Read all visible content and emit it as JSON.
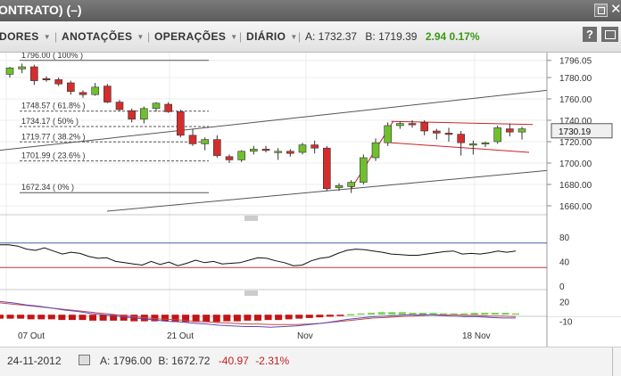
{
  "window": {
    "title": "ONTRATO) (–)",
    "close_glyph": "✕",
    "maximize_icon": "maximize-icon"
  },
  "toolbar": {
    "indicators_label": "DORES",
    "annotations_label": "ANOTAÇÕES",
    "operations_label": "OPERAÇÕES",
    "period_label": "DIÁRIO",
    "separator": "|",
    "ask": "A: 1732.37",
    "bid": "B: 1719.39",
    "change": "2.94 0.17%",
    "help_label": "?",
    "caret_icon": "chevron-down-icon",
    "expand_icon": "expand-icon"
  },
  "footer": {
    "date": "24-11-2012",
    "ask": "A: 1796.00",
    "bid": "B: 1672.72",
    "change": "-40.97",
    "change_pct": "-2.31%",
    "calendar_icon": "calendar-icon"
  },
  "chart_data": {
    "type": "candlestick",
    "x_labels": [
      "07 Out",
      "21 Out",
      "Nov",
      "18 Nov"
    ],
    "price_axis": {
      "ticks": [
        "1796.05",
        "1780.00",
        "1760.00",
        "1740.00",
        "1720.00",
        "1700.00",
        "1680.00",
        "1660.00"
      ],
      "current_price": "1730.19",
      "range": [
        1655,
        1800
      ]
    },
    "fibonacci": {
      "levels": [
        "1796.00 ( 100% )",
        "1748.57 ( 61.8% )",
        "1734.17 ( 50% )",
        "1719.77 ( 38.2% )",
        "1701.99 ( 23.6% )",
        "1672.34 ( 0% )"
      ]
    },
    "candles": [
      {
        "o": 1783,
        "h": 1790,
        "l": 1780,
        "c": 1789
      },
      {
        "o": 1788,
        "h": 1793,
        "l": 1784,
        "c": 1790
      },
      {
        "o": 1790,
        "h": 1792,
        "l": 1773,
        "c": 1777
      },
      {
        "o": 1779,
        "h": 1781,
        "l": 1776,
        "c": 1778
      },
      {
        "o": 1778,
        "h": 1780,
        "l": 1772,
        "c": 1774
      },
      {
        "o": 1775,
        "h": 1777,
        "l": 1764,
        "c": 1767
      },
      {
        "o": 1766,
        "h": 1768,
        "l": 1761,
        "c": 1764
      },
      {
        "o": 1764,
        "h": 1775,
        "l": 1763,
        "c": 1771
      },
      {
        "o": 1772,
        "h": 1774,
        "l": 1756,
        "c": 1757
      },
      {
        "o": 1757,
        "h": 1759,
        "l": 1749,
        "c": 1750
      },
      {
        "o": 1749,
        "h": 1751,
        "l": 1738,
        "c": 1741
      },
      {
        "o": 1741,
        "h": 1753,
        "l": 1737,
        "c": 1751
      },
      {
        "o": 1751,
        "h": 1757,
        "l": 1748,
        "c": 1756
      },
      {
        "o": 1755,
        "h": 1757,
        "l": 1747,
        "c": 1748
      },
      {
        "o": 1748,
        "h": 1750,
        "l": 1724,
        "c": 1726
      },
      {
        "o": 1726,
        "h": 1732,
        "l": 1716,
        "c": 1718
      },
      {
        "o": 1718,
        "h": 1724,
        "l": 1712,
        "c": 1722
      },
      {
        "o": 1722,
        "h": 1726,
        "l": 1705,
        "c": 1707
      },
      {
        "o": 1706,
        "h": 1708,
        "l": 1700,
        "c": 1703
      },
      {
        "o": 1703,
        "h": 1712,
        "l": 1701,
        "c": 1711
      },
      {
        "o": 1711,
        "h": 1716,
        "l": 1708,
        "c": 1713
      },
      {
        "o": 1713,
        "h": 1716,
        "l": 1710,
        "c": 1712
      },
      {
        "o": 1711,
        "h": 1714,
        "l": 1703,
        "c": 1711
      },
      {
        "o": 1711,
        "h": 1713,
        "l": 1706,
        "c": 1709
      },
      {
        "o": 1710,
        "h": 1719,
        "l": 1708,
        "c": 1717
      },
      {
        "o": 1717,
        "h": 1721,
        "l": 1709,
        "c": 1714
      },
      {
        "o": 1714,
        "h": 1716,
        "l": 1674,
        "c": 1676
      },
      {
        "o": 1677,
        "h": 1681,
        "l": 1674,
        "c": 1679
      },
      {
        "o": 1678,
        "h": 1684,
        "l": 1672,
        "c": 1682
      },
      {
        "o": 1682,
        "h": 1708,
        "l": 1680,
        "c": 1705
      },
      {
        "o": 1705,
        "h": 1723,
        "l": 1702,
        "c": 1719
      },
      {
        "o": 1719,
        "h": 1738,
        "l": 1716,
        "c": 1735
      },
      {
        "o": 1735,
        "h": 1739,
        "l": 1732,
        "c": 1737
      },
      {
        "o": 1737,
        "h": 1740,
        "l": 1733,
        "c": 1736
      },
      {
        "o": 1738,
        "h": 1740,
        "l": 1726,
        "c": 1730
      },
      {
        "o": 1730,
        "h": 1732,
        "l": 1722,
        "c": 1728
      },
      {
        "o": 1728,
        "h": 1733,
        "l": 1720,
        "c": 1727
      },
      {
        "o": 1727,
        "h": 1730,
        "l": 1707,
        "c": 1719
      },
      {
        "o": 1717,
        "h": 1721,
        "l": 1708,
        "c": 1718
      },
      {
        "o": 1718,
        "h": 1720,
        "l": 1715,
        "c": 1719
      },
      {
        "o": 1720,
        "h": 1735,
        "l": 1718,
        "c": 1733
      },
      {
        "o": 1732,
        "h": 1737,
        "l": 1725,
        "c": 1729
      },
      {
        "o": 1729,
        "h": 1734,
        "l": 1722,
        "c": 1732
      }
    ],
    "indicator1": {
      "ticks": [
        "80",
        "40",
        "0"
      ],
      "range": [
        0,
        100
      ],
      "upper_line": 70,
      "lower_line": 30,
      "values": [
        67,
        67,
        65,
        60,
        58,
        62,
        57,
        52,
        55,
        53,
        48,
        45,
        46,
        40,
        38,
        36,
        34,
        40,
        35,
        39,
        33,
        37,
        42,
        38,
        40,
        36,
        37,
        38,
        42,
        46,
        45,
        41,
        38,
        33,
        34,
        41,
        45,
        47,
        53,
        58,
        60,
        59,
        57,
        55,
        52,
        51,
        50,
        50,
        52,
        54,
        56,
        57,
        52,
        53,
        52,
        54,
        57,
        55,
        57
      ]
    },
    "indicator2": {
      "ticks": [
        "20",
        "-10"
      ],
      "range": [
        -20,
        30
      ],
      "histogram": [
        -6,
        -6,
        -6,
        -7,
        -7,
        -7,
        -8,
        -8,
        -8,
        -9,
        -9,
        -9,
        -9,
        -10,
        -10,
        -10,
        -10,
        -11,
        -11,
        -11,
        -11,
        -11,
        -10,
        -10,
        -9,
        -9,
        -8,
        -8,
        -7,
        -6,
        -5,
        -4,
        -3,
        -1,
        1,
        2,
        3,
        4,
        4,
        4,
        3,
        3,
        3,
        2,
        2,
        2,
        3,
        3,
        3,
        3,
        2
      ],
      "line1": [
        18,
        16,
        14,
        12,
        10,
        8,
        6,
        4,
        2,
        0,
        -2,
        -4,
        -6,
        -7,
        -8,
        -10,
        -11,
        -12,
        -13,
        -14,
        -14,
        -15,
        -15,
        -15,
        -14,
        -13,
        -11,
        -9,
        -7,
        -5,
        -4,
        -3,
        -2,
        -1,
        0,
        0,
        -1,
        -1,
        -2,
        -2,
        -3
      ],
      "line2": [
        20,
        18,
        15,
        13,
        10,
        7,
        5,
        2,
        0,
        -2,
        -4,
        -6,
        -8,
        -10,
        -11,
        -13,
        -14,
        -16,
        -17,
        -18,
        -18,
        -19,
        -18,
        -17,
        -15,
        -13,
        -10,
        -7,
        -5,
        -3,
        -2,
        -1,
        0,
        0,
        -1,
        -2,
        -3,
        -3,
        -4,
        -5,
        -5
      ]
    }
  }
}
